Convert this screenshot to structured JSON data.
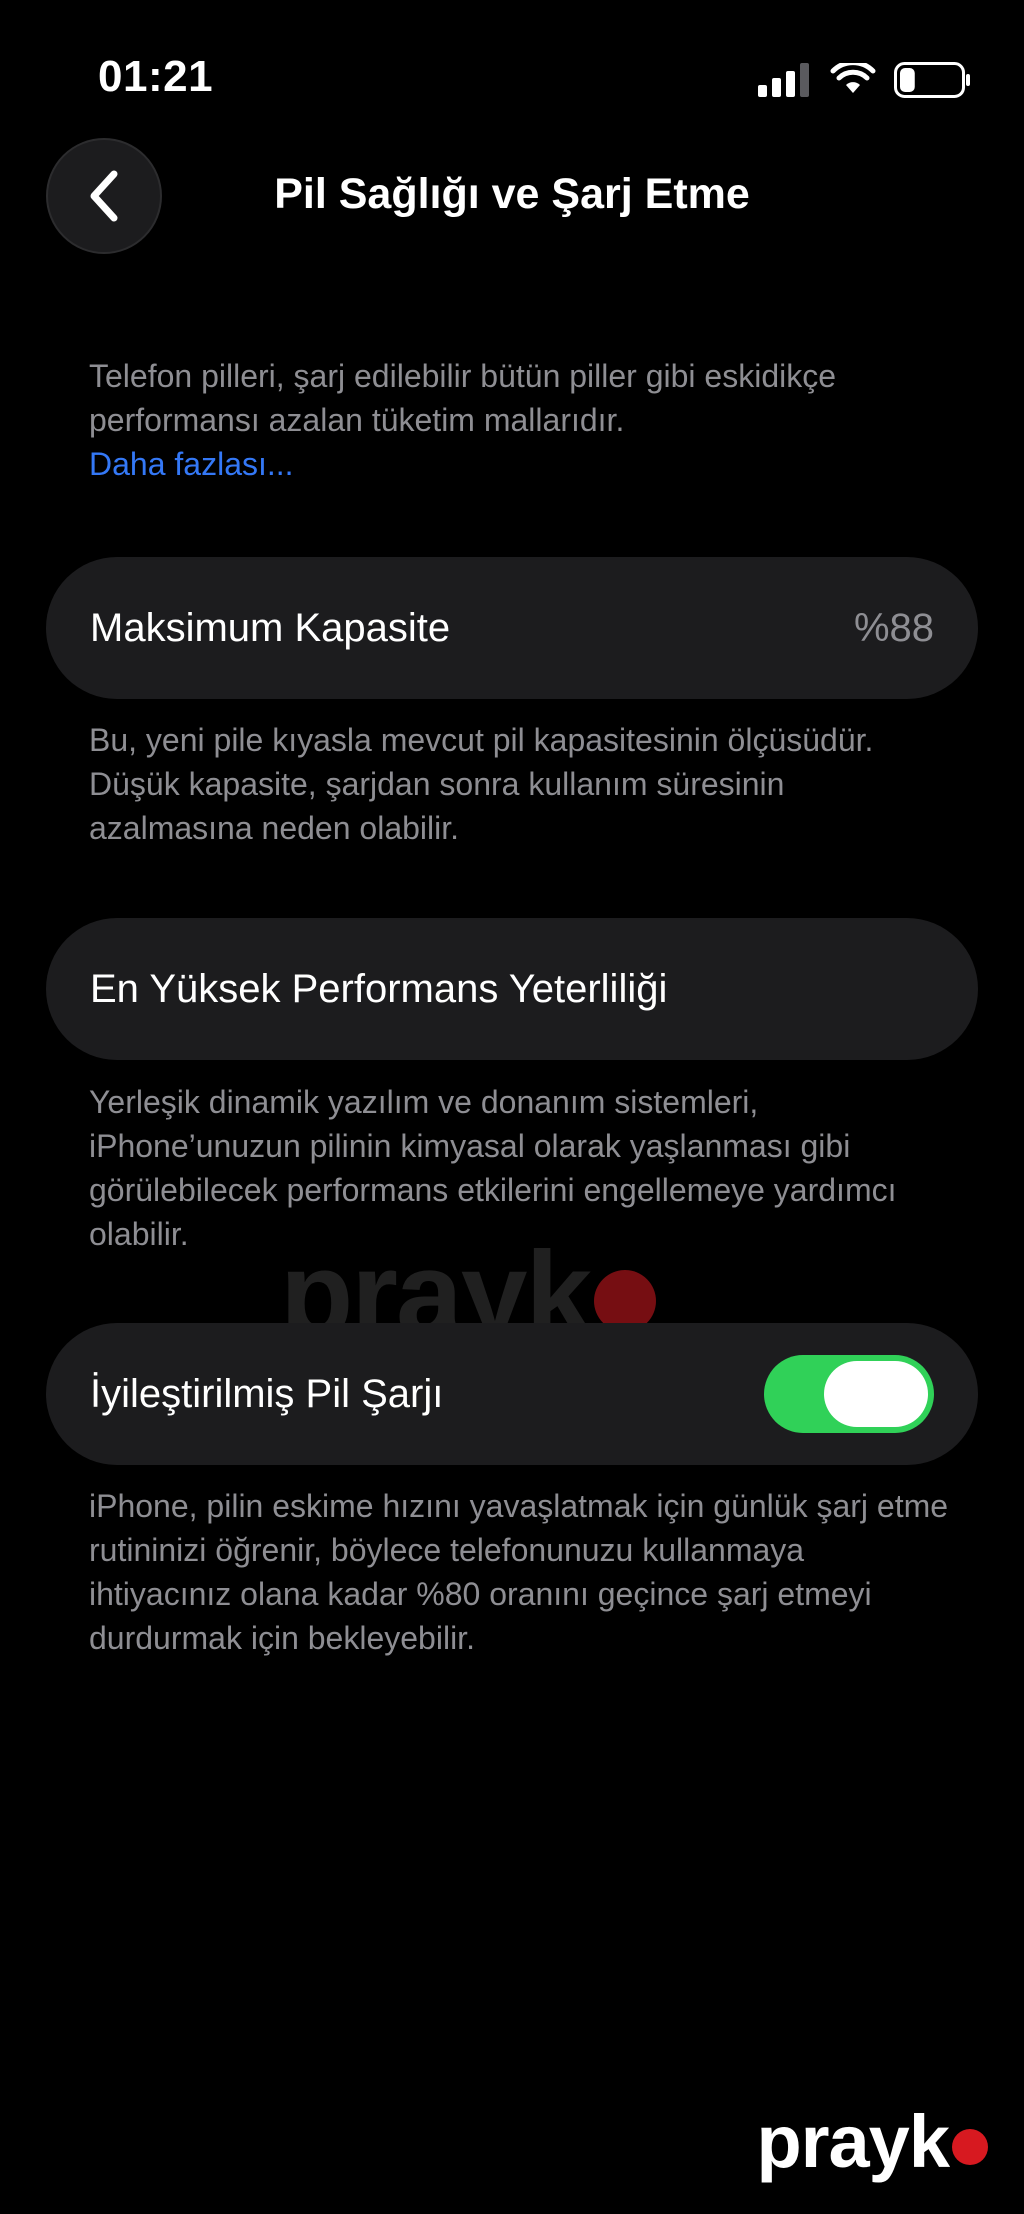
{
  "status_bar": {
    "time": "01:21",
    "icons": [
      "cellular-signal-icon",
      "wifi-icon",
      "battery-icon"
    ],
    "battery_level": 0.25
  },
  "nav": {
    "back_icon": "chevron-left-icon",
    "title": "Pil Sağlığı ve Şarj Etme"
  },
  "intro": {
    "text": "Telefon pilleri, şarj edilebilir bütün piller gibi eskidikçe performansı azalan tüketim mallarıdır.",
    "link": "Daha fazlası..."
  },
  "max_capacity": {
    "label": "Maksimum Kapasite",
    "value": "%88",
    "description": "Bu, yeni pile kıyasla mevcut pil kapasitesinin ölçüsüdür. Düşük kapasite, şarjdan sonra kullanım süresinin azalmasına neden olabilir."
  },
  "peak_performance": {
    "label": "En Yüksek Performans Yeterliliği",
    "description": "Yerleşik dinamik yazılım ve donanım sistemleri, iPhone’unuzun pilinin kimyasal olarak yaşlanması gibi görülebilecek performans etkilerini engellemeye yardımcı olabilir."
  },
  "optimized_charging": {
    "label": "İyileştirilmiş Pil Şarjı",
    "enabled": true,
    "description": "iPhone, pilin eskime hızını yavaşlatmak için günlük şarj etme rutininizi öğrenir, böylece telefonunuzu kullanmaya ihtiyacınız olana kadar %80 oranını geçince şarj etmeyi durdurmak için bekleyebilir."
  },
  "watermark": {
    "text": "prayk"
  },
  "colors": {
    "background": "#000000",
    "cell": "#1c1c1e",
    "secondary_text": "#8e8e93",
    "link": "#3478f6",
    "toggle_on": "#30d158",
    "brand_red": "#d71920"
  }
}
